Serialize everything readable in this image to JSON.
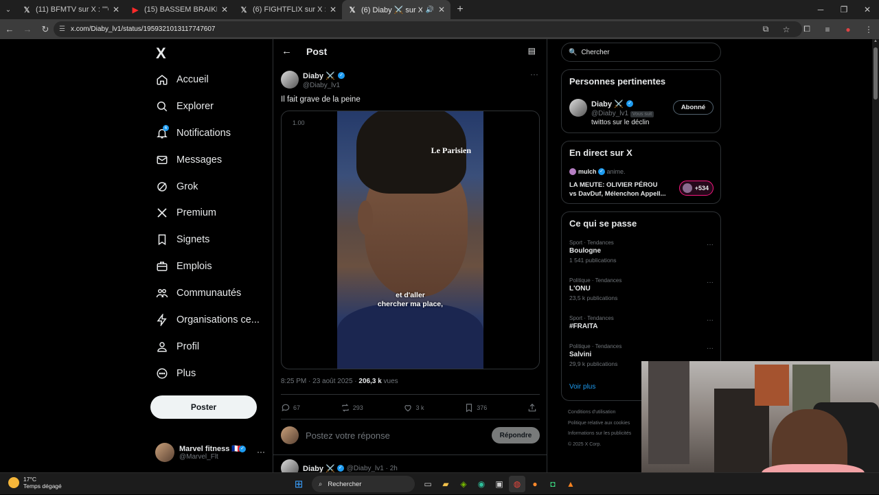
{
  "browser": {
    "tabs": [
      {
        "favicon": "x-logo-icon",
        "title": "(11) BFMTV sur X : \"\"On est dan",
        "active": false
      },
      {
        "favicon": "youtube-icon",
        "title": "(15) BASSEM BRAIKI LIVE TIKTO",
        "active": false
      },
      {
        "favicon": "x-logo-icon",
        "title": "(6) FIGHTFLIX sur X : \"Streamer",
        "active": false
      },
      {
        "favicon": "x-logo-icon",
        "title": "(6) Diaby ⚔️ sur X : \"Il fait g",
        "active": true
      }
    ],
    "new_tab": "+",
    "url": "x.com/Diaby_lv1/status/1959321013117747607"
  },
  "sidebar": {
    "logo": "X",
    "items": [
      {
        "label": "Accueil",
        "icon": "home-icon"
      },
      {
        "label": "Explorer",
        "icon": "search-icon"
      },
      {
        "label": "Notifications",
        "icon": "bell-icon",
        "badge": "6"
      },
      {
        "label": "Messages",
        "icon": "envelope-icon"
      },
      {
        "label": "Grok",
        "icon": "grok-icon"
      },
      {
        "label": "Premium",
        "icon": "x-logo-icon"
      },
      {
        "label": "Signets",
        "icon": "bookmark-icon"
      },
      {
        "label": "Emplois",
        "icon": "briefcase-icon"
      },
      {
        "label": "Communautés",
        "icon": "people-icon"
      },
      {
        "label": "Organisations ce...",
        "icon": "lightning-icon"
      },
      {
        "label": "Profil",
        "icon": "person-icon"
      },
      {
        "label": "Plus",
        "icon": "more-circle-icon"
      }
    ],
    "post_button": "Poster",
    "account": {
      "name": "Marvel fitness 🇫🇷",
      "handle": "@Marvel_Flt",
      "more": "···"
    }
  },
  "post": {
    "header_title": "Post",
    "author_name": "Diaby ⚔️",
    "author_handle": "@Diaby_lv1",
    "more": "···",
    "text": "Il fait grave de la peine",
    "video": {
      "speed": "1.00",
      "watermark": "Le Parisien",
      "subtitle_line1": "et d'aller",
      "subtitle_line2": "chercher ma place,"
    },
    "meta": {
      "time": "8:25 PM · 23 août 2025 · ",
      "views": "206,3 k",
      "views_label": " vues"
    },
    "actions": {
      "replies": "67",
      "reposts": "293",
      "likes": "3 k",
      "bookmarks": "376"
    },
    "reply": {
      "placeholder": "Postez votre réponse",
      "button": "Répondre"
    },
    "next": {
      "name": "Diaby ⚔️",
      "handle": "@Diaby_lv1 · 2h"
    }
  },
  "right": {
    "search_placeholder": "Chercher",
    "relevant": {
      "title": "Personnes pertinentes",
      "name": "Diaby ⚔️",
      "handle": "@Diaby_lv1",
      "follows_you": "Vous suit",
      "bio": "twittos sur le déclin",
      "follow_button": "Abonné"
    },
    "live": {
      "title": "En direct sur X",
      "host": "mulch",
      "host_status": "anime.",
      "line1": "LA MEUTE: OLIVIER PÉROU",
      "line2": "vs DavDuf, Mélenchon Appell...",
      "listeners": "+534"
    },
    "trends": {
      "title": "Ce qui se passe",
      "items": [
        {
          "category": "Sport · Tendances",
          "name": "Boulogne",
          "count": "1 541 publications"
        },
        {
          "category": "Politique · Tendances",
          "name": "L'ONU",
          "count": "23,5 k publications"
        },
        {
          "category": "Sport · Tendances",
          "name": "#FRAITA",
          "count": ""
        },
        {
          "category": "Politique · Tendances",
          "name": "Salvini",
          "count": "29,9 k publications"
        }
      ],
      "show_more": "Voir plus"
    },
    "footer": {
      "l1": "Conditions d'utilisation",
      "l2": "Politique relative aux cookies",
      "l3": "Informations sur les publicités",
      "l4": "© 2025 X Corp."
    }
  },
  "taskbar": {
    "temp": "17°C",
    "weather": "Temps dégagé",
    "search": "Rechercher"
  }
}
